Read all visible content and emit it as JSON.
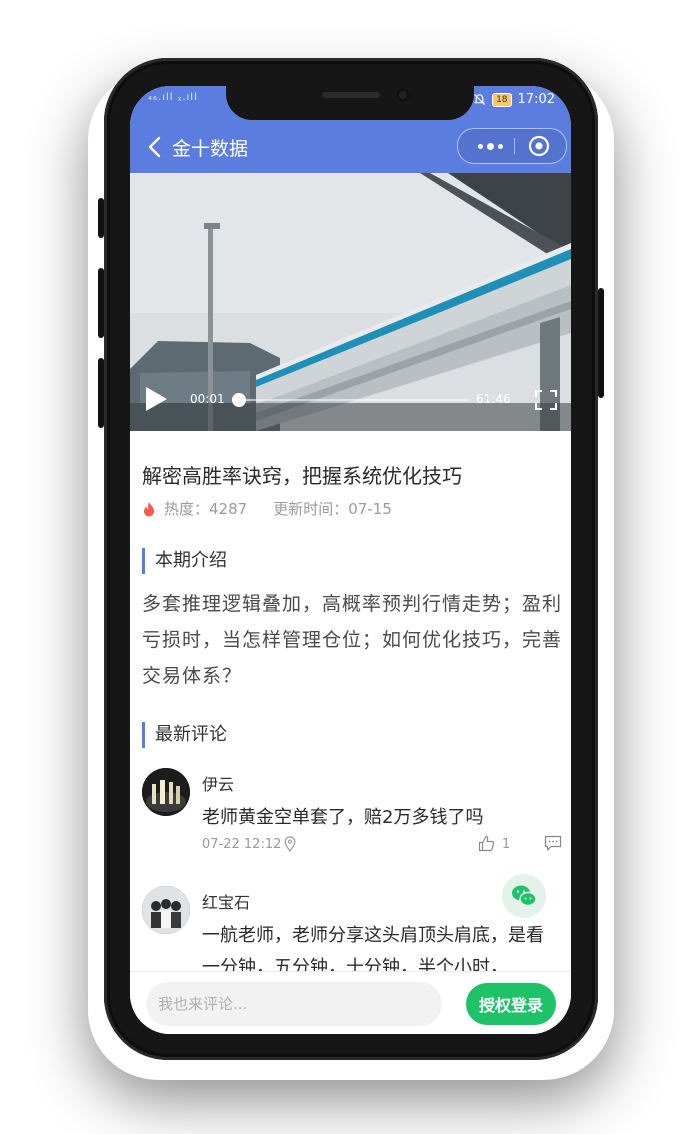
{
  "status_bar": {
    "signal": "₄₆.ıll ᵪ.ıll",
    "battery": "18",
    "time": "17:02"
  },
  "nav": {
    "title": "金十数据"
  },
  "video": {
    "current_time": "00:01",
    "total_time": "61:46",
    "progress": 0.02
  },
  "article": {
    "title": "解密高胜率诀窍，把握系统优化技巧",
    "heat": "热度：4287",
    "updated": "更新时间：07-15"
  },
  "intro": {
    "heading": "本期介绍",
    "text": "多套推理逻辑叠加，高概率预判行情走势；盈利亏损时，当怎样管理仓位；如何优化技巧，完善交易体系？"
  },
  "comments": {
    "heading": "最新评论",
    "items": [
      {
        "name": "伊云",
        "text": "老师黄金空单套了，赔2万多钱了吗",
        "time": "07-22 12:12",
        "likes": "1"
      },
      {
        "name": "红宝石",
        "text": "一航老师，老师分享这头肩顶头肩底，是看一分钟，五分钟，十分钟，半个小时，"
      }
    ]
  },
  "bottom": {
    "placeholder": "我也来评论...",
    "login": "授权登录"
  },
  "colors": {
    "nav": "#5b7de0",
    "accent_green": "#1ec368",
    "heat_icon": "#f25a4a"
  }
}
